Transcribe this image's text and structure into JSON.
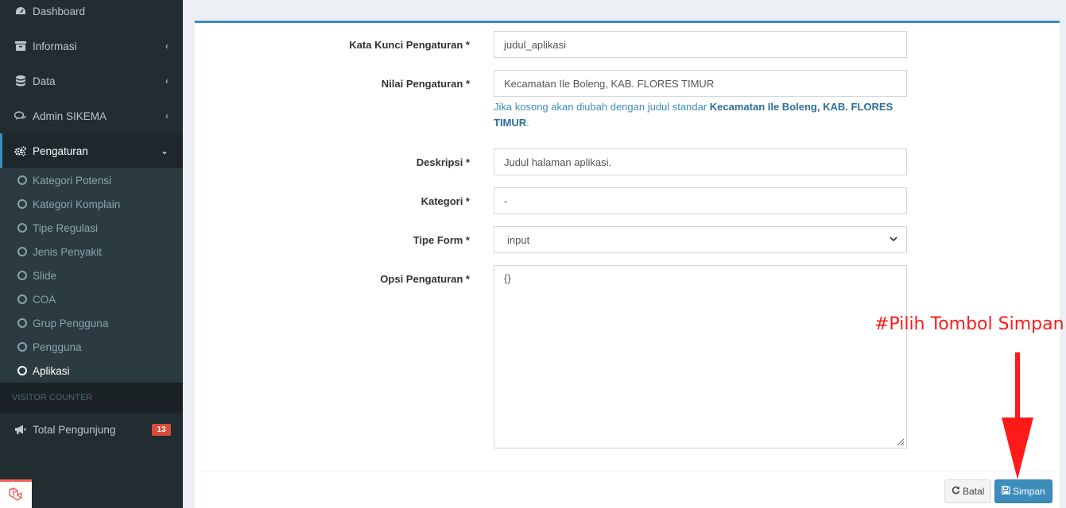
{
  "sidebar": {
    "menu": [
      {
        "label": "Dashboard",
        "icon": "dashboard-icon"
      },
      {
        "label": "Informasi",
        "icon": "archive-icon"
      },
      {
        "label": "Data",
        "icon": "database-icon"
      },
      {
        "label": "Admin SIKEMA",
        "icon": "comments-icon"
      },
      {
        "label": "Pengaturan",
        "icon": "gears-icon"
      }
    ],
    "submenu": [
      {
        "label": "Kategori Potensi"
      },
      {
        "label": "Kategori Komplain"
      },
      {
        "label": "Tipe Regulasi"
      },
      {
        "label": "Jenis Penyakit"
      },
      {
        "label": "Slide"
      },
      {
        "label": "COA"
      },
      {
        "label": "Grup Pengguna"
      },
      {
        "label": "Pengguna"
      },
      {
        "label": "Aplikasi"
      }
    ],
    "section_header": "VISITOR COUNTER",
    "visitor": {
      "label": "Total Pengunjung",
      "count": "13"
    }
  },
  "form": {
    "key": {
      "label": "Kata Kunci Pengaturan *",
      "value": "judul_aplikasi"
    },
    "value": {
      "label": "Nilai Pengaturan *",
      "value": "Kecamatan Ile Boleng, KAB. FLORES TIMUR",
      "help_prefix": "Jika kosong akan diubah dengan judul standar ",
      "help_bold": "Kecamatan Ile Boleng, KAB. FLORES TIMUR",
      "help_suffix": "."
    },
    "description": {
      "label": "Deskripsi *",
      "value": "Judul halaman aplikasi."
    },
    "category": {
      "label": "Kategori *",
      "value": "-"
    },
    "form_type": {
      "label": "Tipe Form *",
      "value": "input"
    },
    "options": {
      "label": "Opsi Pengaturan *",
      "value": "{}"
    }
  },
  "buttons": {
    "cancel": "Batal",
    "save": "Simpan"
  },
  "annotation": {
    "text": "#Pilih Tombol Simpan",
    "color": "#ff1a1a"
  },
  "colors": {
    "primary": "#3c8dbc",
    "sidebar": "#222d32",
    "badge": "#dd4b39"
  }
}
